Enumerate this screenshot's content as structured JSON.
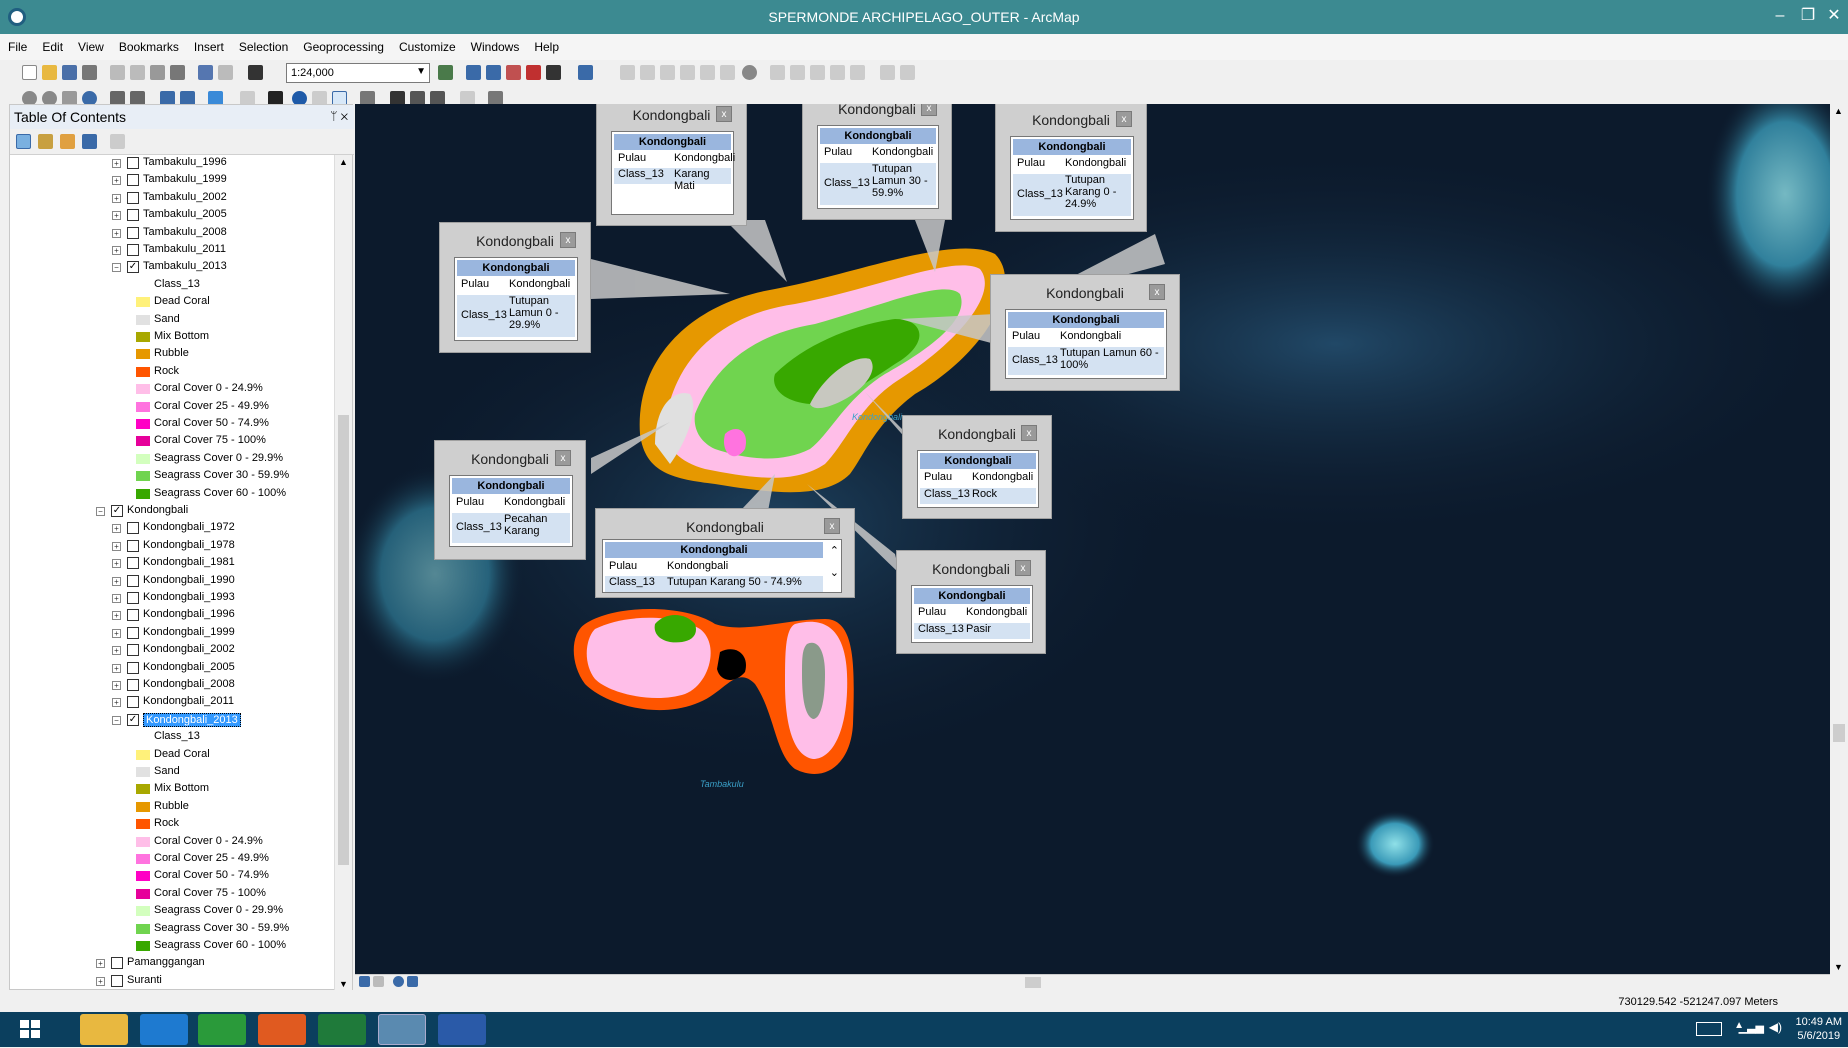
{
  "window": {
    "title": "SPERMONDE ARCHIPELAGO_OUTER - ArcMap",
    "minimize": "–",
    "restore": "❐",
    "close": "✕"
  },
  "menu": [
    "File",
    "Edit",
    "View",
    "Bookmarks",
    "Insert",
    "Selection",
    "Geoprocessing",
    "Customize",
    "Windows",
    "Help"
  ],
  "toolbar": {
    "scale": "1:24,000"
  },
  "toc": {
    "title": "Table Of Contents",
    "pin": "ᛘ ✕",
    "items": [
      {
        "type": "layer",
        "indent": 1,
        "label": "Tambakulu_1996",
        "checked": false
      },
      {
        "type": "layer",
        "indent": 1,
        "label": "Tambakulu_1999",
        "checked": false
      },
      {
        "type": "layer",
        "indent": 1,
        "label": "Tambakulu_2002",
        "checked": false
      },
      {
        "type": "layer",
        "indent": 1,
        "label": "Tambakulu_2005",
        "checked": false
      },
      {
        "type": "layer",
        "indent": 1,
        "label": "Tambakulu_2008",
        "checked": false
      },
      {
        "type": "layer",
        "indent": 1,
        "label": "Tambakulu_2011",
        "checked": false
      },
      {
        "type": "layer",
        "indent": 1,
        "label": "Tambakulu_2013",
        "checked": true,
        "expanded": true
      },
      {
        "type": "field",
        "label": "Class_13"
      },
      {
        "type": "legend",
        "label": "Dead Coral",
        "color": "#fff17a"
      },
      {
        "type": "legend",
        "label": "Sand",
        "color": "#e1e1e1"
      },
      {
        "type": "legend",
        "label": "Mix Bottom",
        "color": "#a8a800"
      },
      {
        "type": "legend",
        "label": "Rubble",
        "color": "#e69800"
      },
      {
        "type": "legend",
        "label": "Rock",
        "color": "#ff5500"
      },
      {
        "type": "legend",
        "label": "Coral Cover  0 - 24.9%",
        "color": "#ffbee8"
      },
      {
        "type": "legend",
        "label": "Coral Cover 25 - 49.9%",
        "color": "#ff73df"
      },
      {
        "type": "legend",
        "label": "Coral Cover 50 - 74.9%",
        "color": "#ff00c5"
      },
      {
        "type": "legend",
        "label": "Coral Cover 75 - 100%",
        "color": "#e6009a"
      },
      {
        "type": "legend",
        "label": "Seagrass Cover 0 - 29.9%",
        "color": "#d3ffbe"
      },
      {
        "type": "legend",
        "label": "Seagrass Cover 30 - 59.9%",
        "color": "#70d44f"
      },
      {
        "type": "legend",
        "label": "Seagrass Cover 60 - 100%",
        "color": "#38a800"
      },
      {
        "type": "group",
        "indent": 0,
        "label": "Kondongbali",
        "checked": true,
        "expanded": true
      },
      {
        "type": "layer",
        "indent": 1,
        "label": "Kondongbali_1972",
        "checked": false
      },
      {
        "type": "layer",
        "indent": 1,
        "label": "Kondongbali_1978",
        "checked": false
      },
      {
        "type": "layer",
        "indent": 1,
        "label": "Kondongbali_1981",
        "checked": false
      },
      {
        "type": "layer",
        "indent": 1,
        "label": "Kondongbali_1990",
        "checked": false
      },
      {
        "type": "layer",
        "indent": 1,
        "label": "Kondongbali_1993",
        "checked": false
      },
      {
        "type": "layer",
        "indent": 1,
        "label": "Kondongbali_1996",
        "checked": false
      },
      {
        "type": "layer",
        "indent": 1,
        "label": "Kondongbali_1999",
        "checked": false
      },
      {
        "type": "layer",
        "indent": 1,
        "label": "Kondongbali_2002",
        "checked": false
      },
      {
        "type": "layer",
        "indent": 1,
        "label": "Kondongbali_2005",
        "checked": false
      },
      {
        "type": "layer",
        "indent": 1,
        "label": "Kondongbali_2008",
        "checked": false
      },
      {
        "type": "layer",
        "indent": 1,
        "label": "Kondongbali_2011",
        "checked": false
      },
      {
        "type": "layer",
        "indent": 1,
        "label": "Kondongbali_2013",
        "checked": true,
        "expanded": true,
        "selected": true
      },
      {
        "type": "field",
        "label": "Class_13"
      },
      {
        "type": "legend",
        "label": "Dead Coral",
        "color": "#fff17a"
      },
      {
        "type": "legend",
        "label": "Sand",
        "color": "#e1e1e1"
      },
      {
        "type": "legend",
        "label": "Mix Bottom",
        "color": "#a8a800"
      },
      {
        "type": "legend",
        "label": "Rubble",
        "color": "#e69800"
      },
      {
        "type": "legend",
        "label": "Rock",
        "color": "#ff5500"
      },
      {
        "type": "legend",
        "label": "Coral Cover  0 - 24.9%",
        "color": "#ffbee8"
      },
      {
        "type": "legend",
        "label": "Coral Cover 25 - 49.9%",
        "color": "#ff73df"
      },
      {
        "type": "legend",
        "label": "Coral Cover 50 - 74.9%",
        "color": "#ff00c5"
      },
      {
        "type": "legend",
        "label": "Coral Cover 75 - 100%",
        "color": "#e6009a"
      },
      {
        "type": "legend",
        "label": "Seagrass Cover 0 - 29.9%",
        "color": "#d3ffbe"
      },
      {
        "type": "legend",
        "label": "Seagrass Cover 30 - 59.9%",
        "color": "#70d44f"
      },
      {
        "type": "legend",
        "label": "Seagrass Cover 60 - 100%",
        "color": "#38a800"
      },
      {
        "type": "group",
        "indent": 0,
        "label": "Pamanggangan",
        "checked": false
      },
      {
        "type": "group",
        "indent": 0,
        "label": "Suranti",
        "checked": false
      }
    ]
  },
  "popups": [
    {
      "title": "Kondongbali",
      "header": "Kondongbali",
      "k1": "Pulau",
      "v1": "Kondongbali",
      "k2": "Class_13",
      "v2": "Karang Mati"
    },
    {
      "title": "Kondongbali",
      "header": "Kondongbali",
      "k1": "Pulau",
      "v1": "Kondongbali",
      "k2": "Class_13",
      "v2": "Tutupan Lamun 30 - 59.9%"
    },
    {
      "title": "Kondongbali",
      "header": "Kondongbali",
      "k1": "Pulau",
      "v1": "Kondongbali",
      "k2": "Class_13",
      "v2": "Tutupan Karang 0 - 24.9%"
    },
    {
      "title": "Kondongbali",
      "header": "Kondongbali",
      "k1": "Pulau",
      "v1": "Kondongbali",
      "k2": "Class_13",
      "v2": "Tutupan Lamun 0 - 29.9%"
    },
    {
      "title": "Kondongbali",
      "header": "Kondongbali",
      "k1": "Pulau",
      "v1": "Kondongbali",
      "k2": "Class_13",
      "v2": "Tutupan Lamun 60 - 100%"
    },
    {
      "title": "Kondongbali",
      "header": "Kondongbali",
      "k1": "Pulau",
      "v1": "Kondongbali",
      "k2": "Class_13",
      "v2": "Rock"
    },
    {
      "title": "Kondongbali",
      "header": "Kondongbali",
      "k1": "Pulau",
      "v1": "Kondongbali",
      "k2": "Class_13",
      "v2": "Pecahan Karang"
    },
    {
      "title": "Kondongbali",
      "header": "Kondongbali",
      "k1": "Pulau",
      "v1": "Kondongbali",
      "k2": "Class_13",
      "v2": "Tutupan Karang 50 - 74.9%"
    },
    {
      "title": "Kondongbali",
      "header": "Kondongbali",
      "k1": "Pulau",
      "v1": "Kondongbali",
      "k2": "Class_13",
      "v2": "Pasir"
    }
  ],
  "popup_close": "x",
  "map_labels": {
    "kondongbali": "Kondongbali",
    "tambakulu": "Tambakulu"
  },
  "status": {
    "coords": "730129.542  -521247.097 Meters"
  },
  "clock": {
    "time": "10:49 AM",
    "date": "5/6/2019"
  }
}
